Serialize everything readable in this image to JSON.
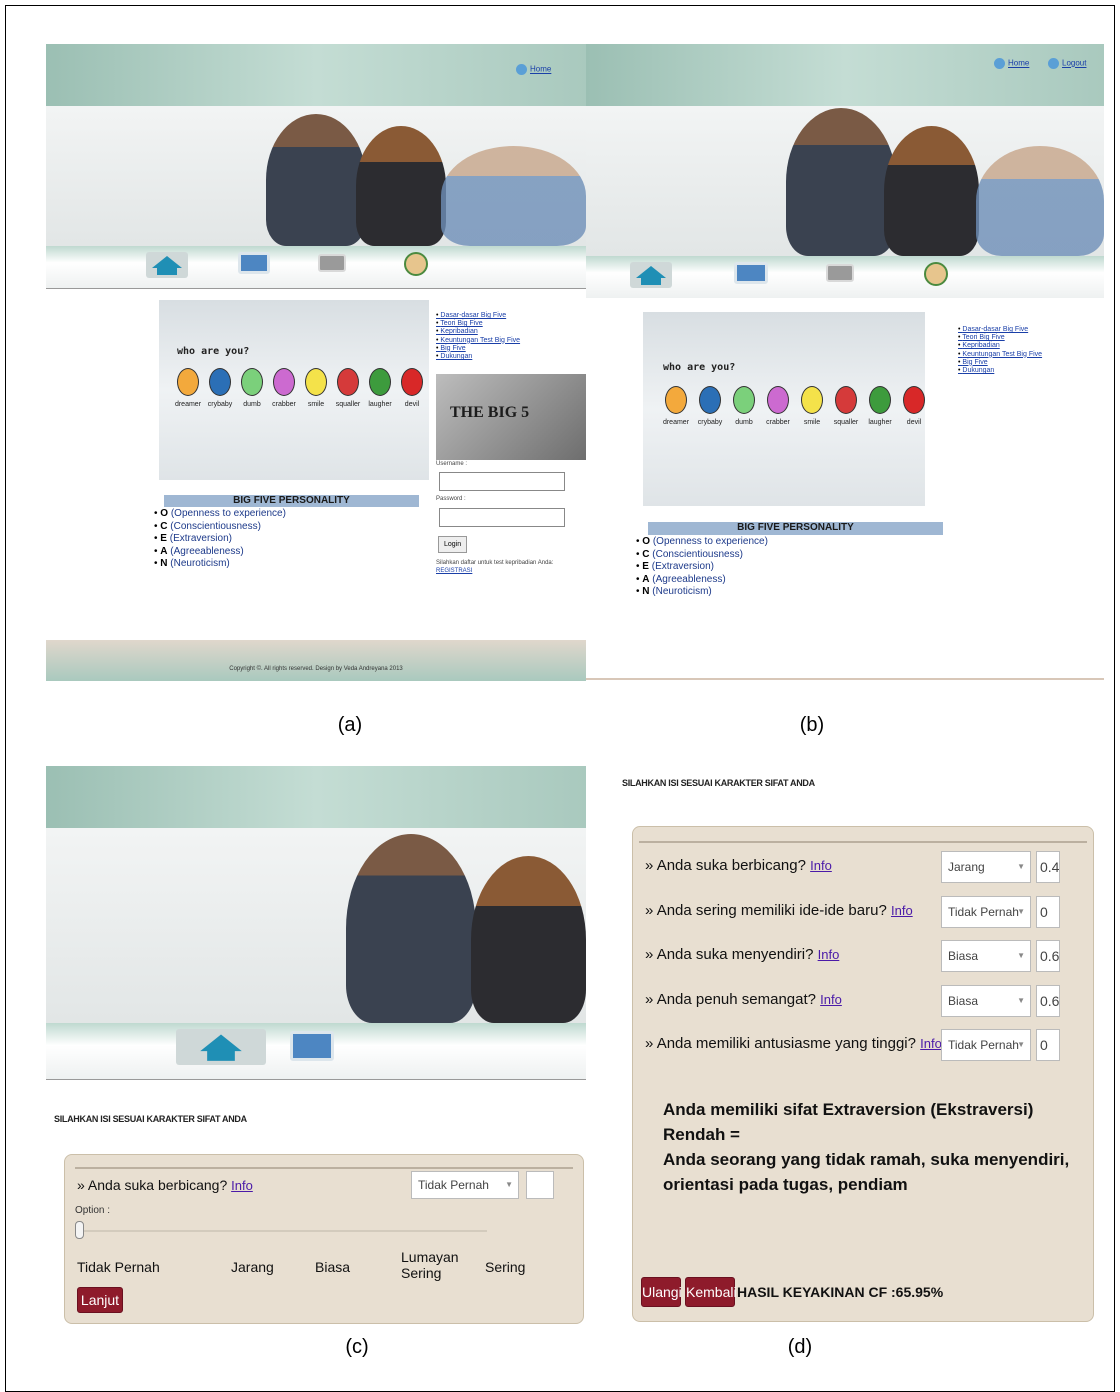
{
  "captions": {
    "a": "(a)",
    "b": "(b)",
    "c": "(c)",
    "d": "(d)"
  },
  "panel_a": {
    "home_link": "Home",
    "who_title": "who are you?",
    "faces": [
      "dreamer",
      "crybaby",
      "dumb",
      "crabber",
      "smile",
      "squaller",
      "laugher",
      "devil"
    ],
    "big5_heading": "BIG FIVE PERSONALITY",
    "traits": [
      {
        "letter": "O",
        "text": "(Openness to experience)"
      },
      {
        "letter": "C",
        "text": "(Conscientiousness)"
      },
      {
        "letter": "E",
        "text": "(Extraversion)"
      },
      {
        "letter": "A",
        "text": "(Agreeableness)"
      },
      {
        "letter": "N",
        "text": "(Neuroticism)"
      }
    ],
    "side_links": [
      "Dasar-dasar Big Five",
      "Teori Big Five",
      "Kepribadian",
      "Keuntungan Test Big Five",
      "Big Five",
      "Dukungan"
    ],
    "username_label": "Username :",
    "password_label": "Password :",
    "login_button": "Login",
    "register_text": "Silahkan daftar untuk test kepribadian Anda:",
    "register_link": "REGISTRASI",
    "footer": "Copyright ©. All rights reserved. Design by Veda Andreyana 2013",
    "big5_image_text": "THE BIG 5"
  },
  "panel_b": {
    "home_link": "Home",
    "logout_link": "Logout",
    "who_title": "who are you?",
    "faces": [
      "dreamer",
      "crybaby",
      "dumb",
      "crabber",
      "smile",
      "squaller",
      "laugher",
      "devil"
    ],
    "big5_heading": "BIG FIVE PERSONALITY",
    "traits": [
      {
        "letter": "O",
        "text": "(Openness to experience)"
      },
      {
        "letter": "C",
        "text": "(Conscientiousness)"
      },
      {
        "letter": "E",
        "text": "(Extraversion)"
      },
      {
        "letter": "A",
        "text": "(Agreeableness)"
      },
      {
        "letter": "N",
        "text": "(Neuroticism)"
      }
    ],
    "side_links": [
      "Dasar-dasar Big Five",
      "Teori Big Five",
      "Kepribadian",
      "Keuntungan Test Big Five",
      "Big Five",
      "Dukungan"
    ]
  },
  "panel_c": {
    "instruction": "SILAHKAN ISI SESUAI KARAKTER SIFAT ANDA",
    "question": "Anda suka berbicang?",
    "info": "Info",
    "select_value": "Tidak Pernah",
    "option_label": "Option :",
    "slider_value": 0,
    "scale": [
      "Tidak Pernah",
      "Jarang",
      "Biasa",
      "Lumayan Sering",
      "Sering"
    ],
    "next_button": "Lanjut"
  },
  "panel_d": {
    "instruction": "SILAHKAN ISI SESUAI KARAKTER SIFAT ANDA",
    "questions": [
      {
        "text": "Anda suka berbicang?",
        "info": "Info",
        "select": "Jarang",
        "value": "0.4"
      },
      {
        "text": "Anda sering memiliki ide-ide baru?",
        "info": "Info",
        "select": "Tidak Pernah",
        "value": "0"
      },
      {
        "text": "Anda suka menyendiri?",
        "info": "Info",
        "select": "Biasa",
        "value": "0.6"
      },
      {
        "text": "Anda penuh semangat?",
        "info": "Info",
        "select": "Biasa",
        "value": "0.6"
      },
      {
        "text": "Anda memiliki antusiasme yang tinggi?",
        "info": "Info",
        "select": "Tidak Pernah",
        "value": "0"
      }
    ],
    "result_line1": "Anda memiliki sifat Extraversion (Ekstraversi) Rendah =",
    "result_line2": "Anda seorang yang tidak ramah, suka menyendiri,",
    "result_line3": "orientasi pada tugas, pendiam",
    "repeat_button": "Ulangi",
    "back_button": "Kembali",
    "cf_text": "HASIL KEYAKINAN CF :65.95%"
  },
  "colors": {
    "header": "#a9c9be",
    "accent_red": "#8e1b2b",
    "box_bg": "#e8dfd1",
    "heading_bar": "#9fb7d3"
  }
}
